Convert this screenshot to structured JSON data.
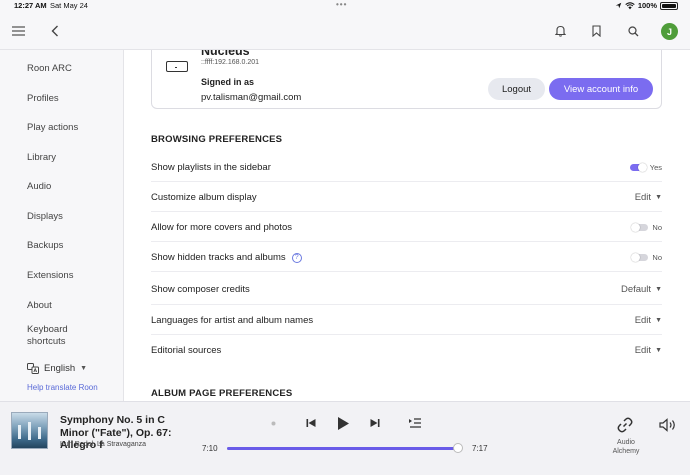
{
  "status": {
    "time": "12:27 AM",
    "date": "Sat May 24",
    "battery": "100%",
    "dots": "•••"
  },
  "topbar": {
    "avatar_letter": "J"
  },
  "sidebar": {
    "items": [
      "Roon ARC",
      "Profiles",
      "Play actions",
      "Library",
      "Audio",
      "Displays",
      "Backups",
      "Extensions",
      "About",
      "Keyboard shortcuts"
    ],
    "language": "English",
    "help_link": "Help translate Roon"
  },
  "account": {
    "device_name": "Nucleus",
    "ip": "::ffff:192.168.0.201",
    "signed_in_label": "Signed in as",
    "email": "pv.talisman@gmail.com",
    "logout_label": "Logout",
    "view_label": "View account info"
  },
  "browsing": {
    "title": "BROWSING PREFERENCES",
    "rows": [
      {
        "label": "Show playlists in the sidebar",
        "value": "Yes"
      },
      {
        "label": "Customize album display",
        "value": "Edit"
      },
      {
        "label": "Allow for more covers and photos",
        "value": "No"
      },
      {
        "label": "Show hidden tracks and albums",
        "value": "No"
      },
      {
        "label": "Show composer credits",
        "value": "Default"
      },
      {
        "label": "Languages for artist and album names",
        "value": "Edit"
      },
      {
        "label": "Editorial sources",
        "value": "Edit"
      }
    ]
  },
  "album_page": {
    "title": "ALBUM PAGE PREFERENCES"
  },
  "player": {
    "title": "Symphony No. 5 in C Minor (\"Fate\"), Op. 67: Allegro f",
    "artist": "Kurt Redel, La Stravaganza",
    "elapsed": "7:10",
    "duration": "7:17",
    "progress_fraction": 0.984,
    "zone": "Audio Alchemy"
  },
  "colors": {
    "accent": "#7b6cf0",
    "progress": "#6a5ce8",
    "link": "#5a6ad8"
  }
}
